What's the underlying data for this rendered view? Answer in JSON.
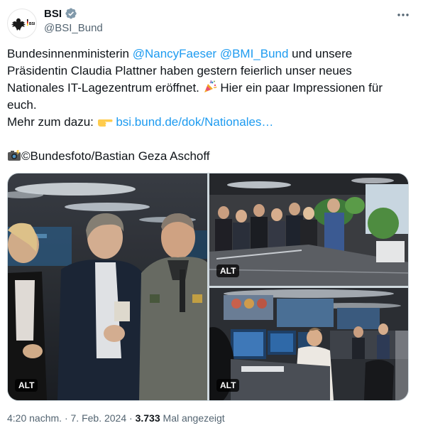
{
  "author": {
    "display_name": "BSI",
    "handle": "@BSI_Bund",
    "avatar_label": "BSI",
    "verified_icon": "verified-badge-icon"
  },
  "tweet": {
    "line1_a": "Bundesinnenministerin ",
    "mention1": "@NancyFaeser",
    "space": " ",
    "mention2": "@BMI_Bund",
    "line1_b": " und unsere",
    "line2": "Präsidentin Claudia Plattner haben gestern feierlich unser neues",
    "line3_a": "Nationales IT-Lagezentrum eröffnet. ",
    "line3_b": " Hier ein paar Impressionen für",
    "line4": "euch.",
    "line5_a": "Mehr zum dazu: ",
    "link": "bsi.bund.de/dok/Nationales…",
    "credit": "©Bundesfoto/Bastian Geza Aschoff",
    "emoji_party": "party-popper-icon",
    "emoji_pointer": "pointing-hand-icon",
    "emoji_camera": "camera-flash-icon"
  },
  "media": {
    "alt_label_1": "ALT",
    "alt_label_2": "ALT",
    "alt_label_3": "ALT"
  },
  "footer": {
    "time": "4:20 nachm.",
    "sep1": " · ",
    "date": "7. Feb. 2024",
    "sep2": " · ",
    "views": "3.733",
    "views_label": " Mal angezeigt"
  },
  "colors": {
    "link": "#1d9bf0",
    "verified": "#829aab",
    "text": "#0f1419",
    "secondary": "#536471"
  }
}
